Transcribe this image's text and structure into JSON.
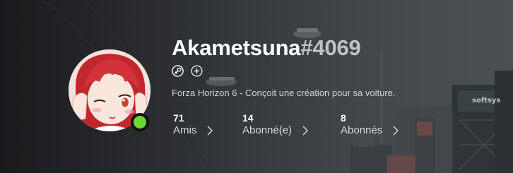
{
  "profile": {
    "gamertag": "Akametsuna",
    "discriminator": "#4069",
    "status": "Forza Horizon 6 - Conçoit une création pour sa voiture.",
    "presence_color": "#6cd62f",
    "icons": [
      "steam-icon",
      "add-icon"
    ],
    "stats": [
      {
        "count": "71",
        "label": "Amis"
      },
      {
        "count": "14",
        "label": "Abonné(e)"
      },
      {
        "count": "8",
        "label": "Abonnés"
      }
    ]
  },
  "background": {
    "sign_text": "softsys"
  }
}
